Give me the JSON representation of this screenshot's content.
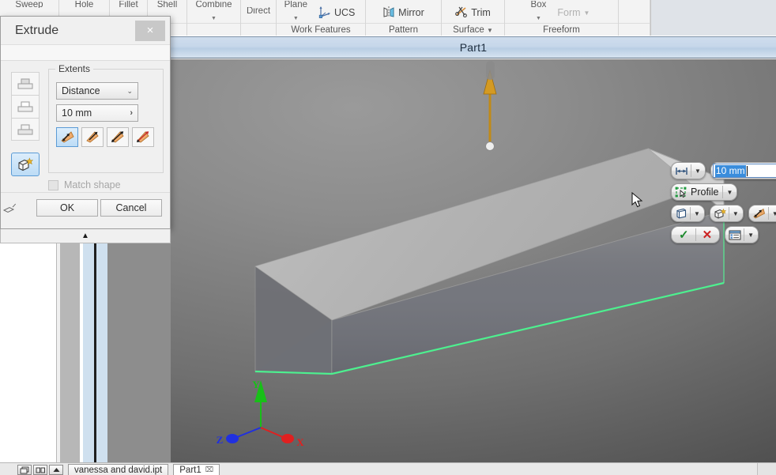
{
  "ribbon": {
    "panels": [
      {
        "label": "",
        "clipped_tops": [
          "Sweep",
          "Hole",
          "Fillet",
          "Shell",
          "Combine"
        ]
      },
      {
        "label": "Work Features",
        "buttons": [
          "UCS"
        ]
      },
      {
        "label": "Pattern",
        "buttons": [
          "Mirror"
        ]
      },
      {
        "label": "Surface",
        "buttons": [
          "Trim"
        ],
        "has_caret": true
      },
      {
        "label": "Freeform",
        "buttons": [
          "Form"
        ]
      }
    ],
    "top_clipped_labels": [
      "Sweep",
      "Hole",
      "Fillet",
      "Shell",
      "Combine",
      "Direct",
      "Plane"
    ],
    "work_features_label": "Work Features",
    "pattern_label": "Pattern",
    "surface_label": "Surface",
    "freeform_label": "Freeform",
    "ucs_label": "UCS",
    "mirror_label": "Mirror",
    "trim_label": "Trim",
    "form_label": "Form",
    "caret_glyph": "▼"
  },
  "document": {
    "title": "Part1"
  },
  "extrude_dialog": {
    "title": "Extrude",
    "close_glyph": "×",
    "extents_legend": "Extents",
    "extents_type": "Distance",
    "select_caret": "⌄",
    "distance_value": "10 mm",
    "distance_caret": "›",
    "direction_buttons": [
      {
        "name": "direction-default",
        "selected": true
      },
      {
        "name": "direction-flipped",
        "selected": false
      },
      {
        "name": "direction-symmetric",
        "selected": false
      },
      {
        "name": "direction-asymmetric",
        "selected": false
      }
    ],
    "operation_buttons": [
      {
        "name": "operation-join",
        "enabled": false
      },
      {
        "name": "operation-cut",
        "enabled": false
      },
      {
        "name": "operation-intersect",
        "enabled": false
      },
      {
        "name": "operation-new-solid",
        "enabled": true,
        "selected": true
      }
    ],
    "match_shape_label": "Match shape",
    "match_shape_checked": false,
    "match_shape_enabled": false,
    "ok_label": "OK",
    "cancel_label": "Cancel",
    "expander_glyph": "▲"
  },
  "mini_toolbar": {
    "distance_value": "10 mm",
    "distance_icon": "distance-measure-icon",
    "play_glyph": "▶",
    "profile_label": "Profile",
    "profile_icon": "profile-select-icon",
    "solid_icon": "solid-body-icon",
    "new_solid_icon": "new-solid-icon",
    "direction_icon": "direction-flip-icon",
    "ok_glyph": "✓",
    "cancel_glyph": "✕",
    "options_icon": "options-list-icon",
    "caret_glyph": "▼"
  },
  "viewport": {
    "axis_triad": {
      "x_label": "X",
      "y_label": "Y",
      "z_label": "Z",
      "x_color": "#e02020",
      "y_color": "#18c018",
      "z_color": "#2030e0"
    },
    "highlight_edge_color": "#46f08c",
    "manipulator_arrow_color": "#c08a18",
    "sketch_plane_color": "#5a6a8c"
  },
  "bottom_bar": {
    "window_buttons": [
      "restore-icon",
      "tile-icon",
      "scroll-up-icon"
    ],
    "tabs": [
      {
        "label": "vanessa and david.ipt",
        "active": false,
        "closable": false
      },
      {
        "label": "Part1",
        "active": true,
        "closable": true
      }
    ],
    "tab_close_glyph": "⌧"
  }
}
